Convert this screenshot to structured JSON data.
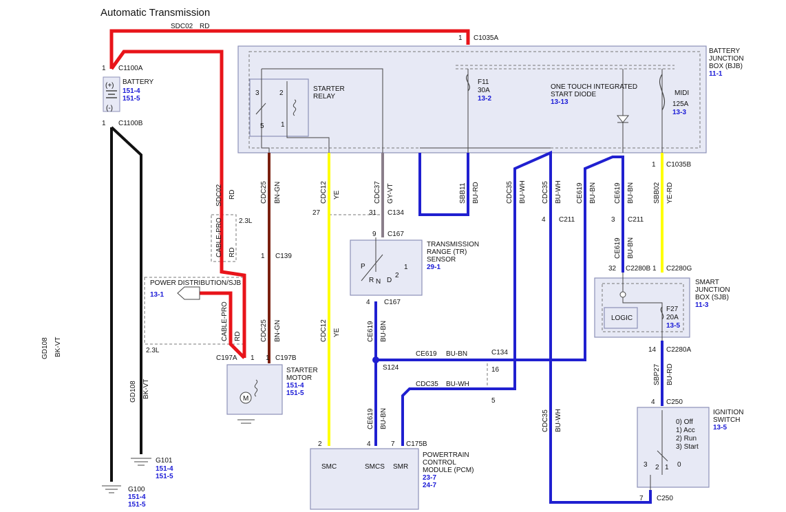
{
  "title": "Automatic Transmission",
  "wire_colors": {
    "red": "#e8141a",
    "brown": "#7a2010",
    "yellow": "#ffff00",
    "gray": "#8a7e8a",
    "blue": "#2020d0",
    "black": "#111111",
    "white": "#ffffff"
  },
  "top_wire": {
    "circuit": "SDC02",
    "color": "RD"
  },
  "battery": {
    "label": "BATTERY",
    "ref1": "151-4",
    "ref2": "151-5",
    "plus": "(+)",
    "minus": "(-)",
    "c_top": "C1100A",
    "c_top_pin": "1",
    "c_bot": "C1100B",
    "c_bot_pin": "1"
  },
  "bjb": {
    "name1": "BATTERY",
    "name2": "JUNCTION",
    "name3": "BOX (BJB)",
    "ref": "11-1",
    "conn": "C1035A",
    "conn_pin": "1",
    "conn_b": "C1035B",
    "conn_b_pin": "1"
  },
  "starter_relay": {
    "name1": "STARTER",
    "name2": "RELAY",
    "p3": "3",
    "p2": "2",
    "p5": "5",
    "p1": "1"
  },
  "fuse_f11": {
    "name": "F11",
    "amp": "30A",
    "ref": "13-2"
  },
  "diode": {
    "name1": "ONE TOUCH INTEGRATED",
    "name2": "START DIODE",
    "ref": "13-13"
  },
  "midi": {
    "name": "MIDI",
    "amp": "125A",
    "ref": "13-3"
  },
  "wires": {
    "sdc02": {
      "circuit": "SDC02",
      "color": "RD"
    },
    "cdc25": {
      "circuit": "CDC25",
      "color": "BN-GN"
    },
    "cdc12": {
      "circuit": "CDC12",
      "color": "YE"
    },
    "cdc37": {
      "circuit": "CDC37",
      "color": "GY-VT"
    },
    "sbb11": {
      "circuit": "SBB11",
      "color": "BU-RD"
    },
    "cdc35a": {
      "circuit": "CDC35",
      "color": "BU-WH"
    },
    "cdc35b": {
      "circuit": "CDC35",
      "color": "BU-WH"
    },
    "ce619a": {
      "circuit": "CE619",
      "color": "BU-BN"
    },
    "ce619b": {
      "circuit": "CE619",
      "color": "BU-BN"
    },
    "ce619c": {
      "circuit": "CE619",
      "color": "BU-BN"
    },
    "sbb02": {
      "circuit": "SBB02",
      "color": "YE-RD"
    },
    "cdc25b": {
      "circuit": "CDC25",
      "color": "BN-GN"
    },
    "cdc12b": {
      "circuit": "CDC12",
      "color": "YE"
    },
    "ce619d": {
      "circuit": "CE619",
      "color": "BU-BN"
    },
    "ce619h": {
      "circuit": "CE619",
      "color": "BU-BN"
    },
    "cdc35h": {
      "circuit": "CDC35",
      "color": "BU-WH"
    },
    "cdc35c": {
      "circuit": "CDC35",
      "color": "BU-WH"
    },
    "sbp27": {
      "circuit": "SBP27",
      "color": "BU-RD"
    },
    "gd108a": {
      "circuit": "GD108",
      "color": "BK-VT"
    },
    "gd108b": {
      "circuit": "GD108",
      "color": "BK-VT"
    },
    "sdc02b": {
      "circuit": "CABLE-PRO",
      "color": "RD"
    },
    "cablepro2": {
      "circuit": "CABLE-PRO",
      "color": "RD"
    }
  },
  "cable_pro_len": "2.3L",
  "cable_pro_len2": "2.3L",
  "connectors": {
    "c134a": {
      "pin": "31",
      "name": "C134"
    },
    "c134b": {
      "pin": "27",
      "name": ""
    },
    "c167a": {
      "pin": "9",
      "name": "C167"
    },
    "c167b": {
      "pin": "4",
      "name": "C167"
    },
    "c139": {
      "pin": "1",
      "name": "C139"
    },
    "c211a": {
      "pin": "4",
      "name": "C211"
    },
    "c211b": {
      "pin": "3",
      "name": "C211"
    },
    "c2280b": {
      "pin": "32",
      "name": "C2280B"
    },
    "c2280g": {
      "pin": "1",
      "name": "C2280G"
    },
    "c2280a": {
      "pin": "14",
      "name": "C2280A"
    },
    "c250a": {
      "pin": "4",
      "name": "C250"
    },
    "c250b": {
      "pin": "7",
      "name": "C250"
    },
    "c197a": {
      "pin": "1",
      "name": "C197A"
    },
    "c197b": {
      "pin": "1",
      "name": "C197B"
    },
    "c134h": {
      "pin": "16",
      "name": "C134"
    },
    "c134h2": {
      "pin": "5",
      "name": ""
    },
    "c175b_2": {
      "pin": "2",
      "name": ""
    },
    "c175b_4": {
      "pin": "4",
      "name": ""
    },
    "c175b_7": {
      "pin": "7",
      "name": "C175B"
    }
  },
  "tr_sensor": {
    "name1": "TRANSMISSION",
    "name2": "RANGE (TR)",
    "name3": "SENSOR",
    "ref": "29-1",
    "p": "P",
    "r": "R",
    "n": "N",
    "d": "D",
    "n2": "2",
    "n1": "1"
  },
  "splice": "S124",
  "pdsjb": {
    "name": "POWER DISTRIBUTION/SJB",
    "ref": "13-1"
  },
  "starter_motor": {
    "name1": "STARTER",
    "name2": "MOTOR",
    "ref1": "151-4",
    "ref2": "151-5",
    "m": "M"
  },
  "sjb": {
    "name1": "SMART",
    "name2": "JUNCTION",
    "name3": "BOX (SJB)",
    "ref": "11-3",
    "logic": "LOGIC",
    "fuse": "F27",
    "amp": "20A",
    "fref": "13-5"
  },
  "pcm": {
    "name1": "POWERTRAIN",
    "name2": "CONTROL",
    "name3": "MODULE (PCM)",
    "ref1": "23-7",
    "ref2": "24-7",
    "smc": "SMC",
    "smcs": "SMCS",
    "smr": "SMR"
  },
  "ignition": {
    "name1": "IGNITION",
    "name2": "SWITCH",
    "ref": "13-5",
    "l0": "0) Off",
    "l1": "1) Acc",
    "l2": "2) Run",
    "l3": "3) Start",
    "p3": "3",
    "p2": "2",
    "p1": "1",
    "p0": "0"
  },
  "grounds": {
    "g101": {
      "name": "G101",
      "ref1": "151-4",
      "ref2": "151-5"
    },
    "g100": {
      "name": "G100",
      "ref1": "151-4",
      "ref2": "151-5"
    }
  }
}
